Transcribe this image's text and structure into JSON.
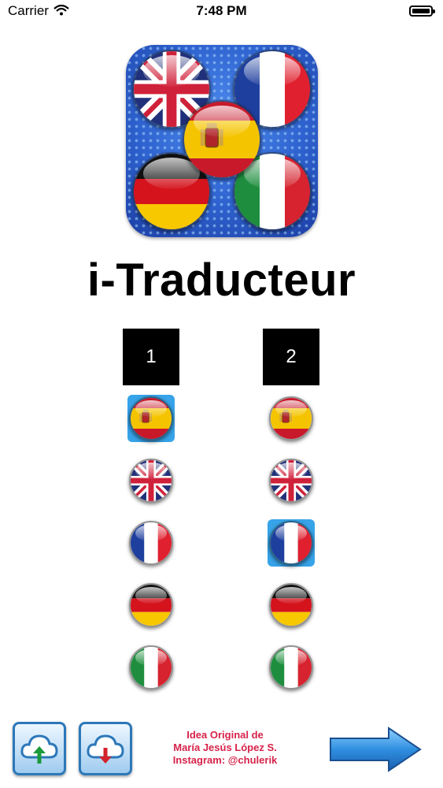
{
  "status_bar": {
    "carrier": "Carrier",
    "time": "7:48 PM"
  },
  "app": {
    "title": "i-Traducteur",
    "logo": "flags-app-icon"
  },
  "columns": [
    {
      "label": "1",
      "flags": [
        "spain",
        "uk",
        "france",
        "germany",
        "italy"
      ],
      "selected": "spain"
    },
    {
      "label": "2",
      "flags": [
        "spain",
        "uk",
        "france",
        "germany",
        "italy"
      ],
      "selected": "france"
    }
  ],
  "footer": {
    "upload_icon": "cloud-upload-icon",
    "download_icon": "cloud-download-icon",
    "credit_line1": "Idea Original de",
    "credit_line2": "María Jesús López S.",
    "credit_line3": "Instagram: @chulerik",
    "next_icon": "arrow-right-icon"
  },
  "colors": {
    "selected": "#37a3e8",
    "credits": "#d6234a",
    "accent": "#2c78b9"
  }
}
